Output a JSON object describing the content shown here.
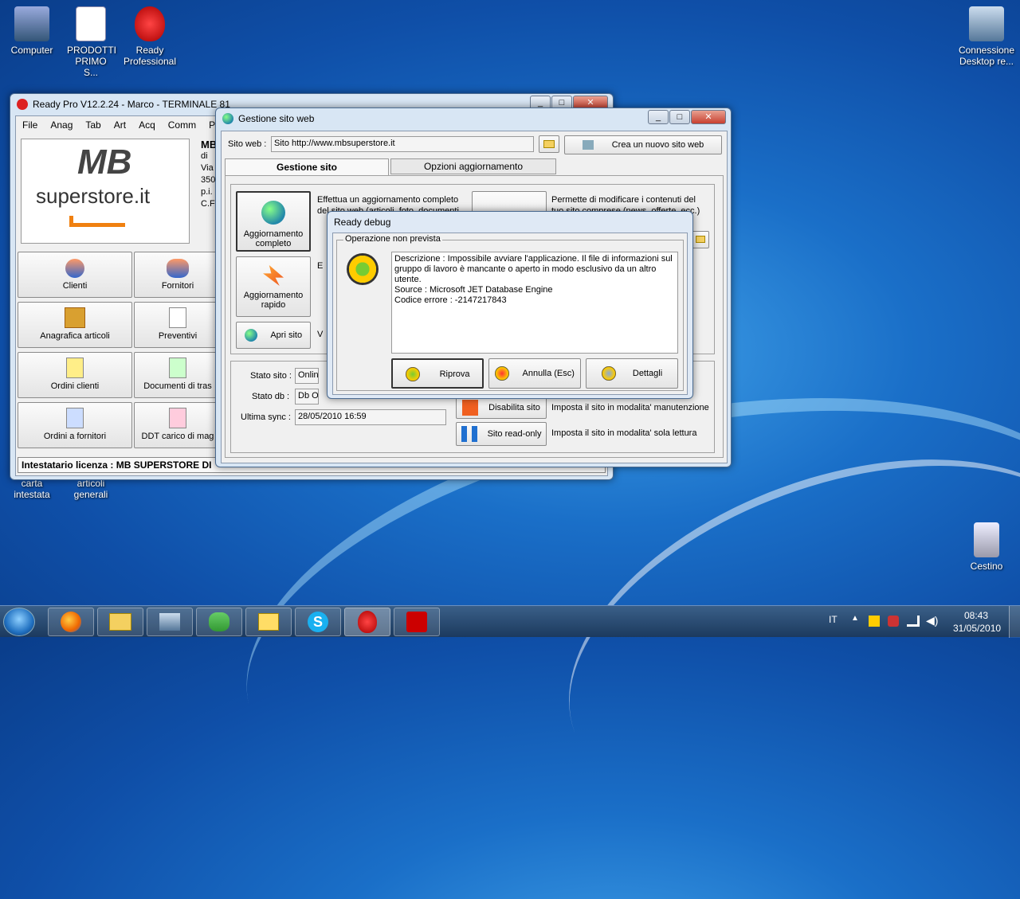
{
  "desktop": {
    "icons": [
      {
        "label": "Computer"
      },
      {
        "label": "PRODOTTI PRIMO S..."
      },
      {
        "label": "Ready Professional"
      },
      {
        "label": "Connessione Desktop re..."
      },
      {
        "label": "carta intestata"
      },
      {
        "label": "articoli generali"
      },
      {
        "label": "Cestino"
      }
    ]
  },
  "main_window": {
    "title": "Ready Pro V12.2.24 - Marco - TERMINALE 81",
    "menu": [
      "File",
      "Anag",
      "Tab",
      "Art",
      "Acq",
      "Comm",
      "P"
    ],
    "logo_mb": "MB",
    "logo_site": "superstore.it",
    "side_text": [
      "MB",
      "di",
      "Via",
      "350",
      "p.i.",
      "C.F"
    ],
    "tiles": [
      "Clienti",
      "Fornitori",
      "Anagrafica articoli",
      "Preventivi",
      "Ordini clienti",
      "Documenti di tras",
      "Ordini a fornitori",
      "DDT carico di mag"
    ],
    "status": "Intestatario licenza : MB SUPERSTORE DI"
  },
  "web_window": {
    "title": "Gestione sito web",
    "site_label": "Sito web :",
    "site_value": "Sito http://www.mbsuperstore.it",
    "new_site_button": "Crea un nuovo sito web",
    "tabs": [
      "Gestione sito",
      "Opzioni aggiornamento"
    ],
    "full_update": "Aggiornamento completo",
    "full_update_desc": "Effettua un aggiornamento completo del sito web (articoli, foto, documenti",
    "quick_update": "Aggiornamento rapido",
    "open_site": "Apri sito",
    "modify_desc": "Permette di modificare i contenuti del tuo sito comprese (news, offerte, ecc.)",
    "stato_sito_label": "Stato sito :",
    "stato_sito_value": "Online",
    "stato_db_label": "Stato db :",
    "stato_db_value": "Db OK",
    "ultima_sync_label": "Ultima sync :",
    "ultima_sync_value": "28/05/2010 16:59",
    "disable_site": "Disabilita sito",
    "readonly_site": "Sito read-only",
    "disable_desc": "Imposta il sito in modalita' manutenzione",
    "readonly_desc": "Imposta il sito in modalita' sola lettura",
    "frag_e": "E",
    "frag_v": "V"
  },
  "dialog": {
    "title": "Ready debug",
    "group": "Operazione non prevista",
    "message": "Descrizione : Impossibile avviare l'applicazione. Il file di informazioni sul gruppo di lavoro è mancante o aperto in modo esclusivo da un altro utente.\nSource : Microsoft JET Database Engine\nCodice errore : -2147217843",
    "retry": "Riprova",
    "cancel": "Annulla (Esc)",
    "details": "Dettagli"
  },
  "taskbar": {
    "lang": "IT",
    "time": "08:43",
    "date": "31/05/2010"
  }
}
